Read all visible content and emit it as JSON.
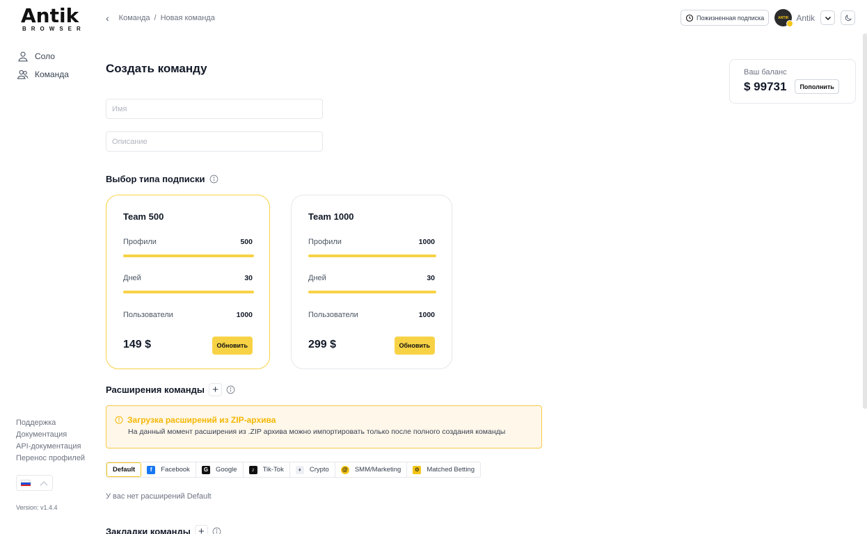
{
  "logo": {
    "main": "Antik",
    "sub": "BROWSER"
  },
  "sidebar": {
    "items": [
      {
        "label": "Соло",
        "icon": "user-icon"
      },
      {
        "label": "Команда",
        "icon": "users-icon"
      }
    ],
    "links": [
      "Поддержка",
      "Документация",
      "API-документация",
      "Перенос профилей"
    ],
    "version": "Version: v1.4.4"
  },
  "breadcrumb": {
    "parent": "Команда",
    "separator": "/",
    "current": "Новая команда"
  },
  "header": {
    "lifetime_label": "Пожизненная подписка",
    "username": "Antik"
  },
  "balance": {
    "label": "Ваш баланс",
    "value": "$ 99731",
    "topup_label": "Пополнить"
  },
  "page": {
    "title": "Создать команду"
  },
  "form": {
    "name_placeholder": "Имя",
    "description_placeholder": "Описание"
  },
  "subscription": {
    "title": "Выбор типа подписки",
    "plans": [
      {
        "name": "Team 500",
        "profiles_label": "Профили",
        "profiles": "500",
        "days_label": "Дней",
        "days": "30",
        "users_label": "Пользователи",
        "users": "1000",
        "price": "149 $",
        "button": "Обновить",
        "selected": true
      },
      {
        "name": "Team 1000",
        "profiles_label": "Профили",
        "profiles": "1000",
        "days_label": "Дней",
        "days": "30",
        "users_label": "Пользователи",
        "users": "1000",
        "price": "299 $",
        "button": "Обновить",
        "selected": false
      }
    ]
  },
  "extensions": {
    "title": "Расширения команды",
    "alert_title": "Загрузка расширений из ZIP-архива",
    "alert_text": "На данный момент расширения из .ZIP архива можно импортировать только после полного создания команды",
    "tabs": [
      "Default",
      "Facebook",
      "Google",
      "Tik-Tok",
      "Crypto",
      "SMM/Marketing",
      "Matched Betting"
    ],
    "active_tab": "Default",
    "empty_text": "У вас нет расширений Default"
  },
  "bookmarks": {
    "title": "Закладки команды"
  },
  "colors": {
    "accent": "#f7d245",
    "alert_bg": "#fff7ea",
    "alert_title": "#f5b700"
  }
}
